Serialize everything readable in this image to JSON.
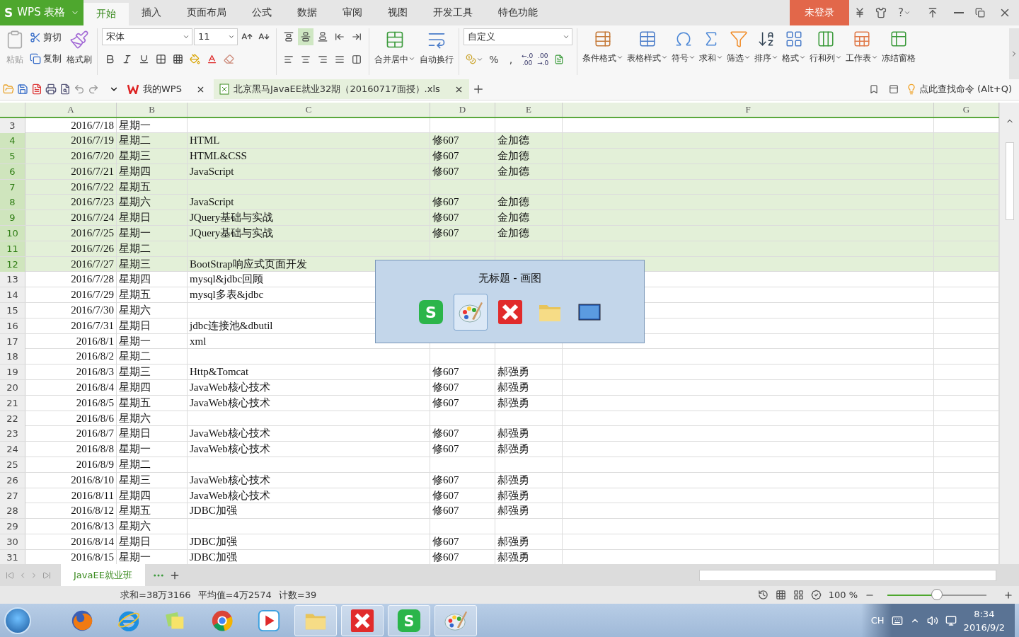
{
  "app_menu": {
    "logo": "S",
    "label": "WPS 表格"
  },
  "menu_tabs": [
    {
      "label": "开始",
      "selected": true
    },
    {
      "label": "插入",
      "selected": false
    },
    {
      "label": "页面布局",
      "selected": false
    },
    {
      "label": "公式",
      "selected": false
    },
    {
      "label": "数据",
      "selected": false
    },
    {
      "label": "审阅",
      "selected": false
    },
    {
      "label": "视图",
      "selected": false
    },
    {
      "label": "开发工具",
      "selected": false
    },
    {
      "label": "特色功能",
      "selected": false
    }
  ],
  "login_button": "未登录",
  "help_label": "?",
  "ribbon": {
    "paste": {
      "label": "粘贴",
      "disabled": true
    },
    "cut": "剪切",
    "copy": "复制",
    "format_painter": "格式刷",
    "font_name": "宋体",
    "font_size": "11",
    "merge": "合并居中",
    "wrap": "自动换行",
    "number_format": "自定义",
    "number_glyphs": [
      "%",
      ","
    ],
    "decimal_buttons": [
      {
        "top": "←.0",
        "bottom": ".00"
      },
      {
        "top": ".00",
        "bottom": "→.0"
      }
    ],
    "commands": [
      {
        "kind": "conditional",
        "label": "条件格式",
        "dropdown": true
      },
      {
        "kind": "table-style",
        "label": "表格样式",
        "dropdown": true
      },
      {
        "kind": "symbol",
        "label": "符号",
        "dropdown": true
      },
      {
        "kind": "sum",
        "label": "求和",
        "dropdown": true
      },
      {
        "kind": "filter",
        "label": "筛选",
        "dropdown": true
      },
      {
        "kind": "sort",
        "label": "排序",
        "dropdown": true
      },
      {
        "kind": "format",
        "label": "格式",
        "dropdown": true
      },
      {
        "kind": "rows-cols",
        "label": "行和列",
        "dropdown": true
      },
      {
        "kind": "worksheet",
        "label": "工作表",
        "dropdown": true
      },
      {
        "kind": "freeze",
        "label": "冻结窗格",
        "dropdown": false
      }
    ]
  },
  "doc_tabs": [
    {
      "kind": "home",
      "label": "我的WPS",
      "selected": false
    },
    {
      "kind": "sheet",
      "label": "北京黑马JavaEE就业32期（20160717面授）.xls",
      "selected": true
    }
  ],
  "command_search": "点此查找命令 (Alt+Q)",
  "sheet": {
    "columns": [
      "A",
      "B",
      "C",
      "D",
      "E",
      "F",
      "G"
    ],
    "rows": [
      {
        "num": "3",
        "cells": [
          "2016/7/18",
          "星期一",
          "",
          "",
          ""
        ],
        "selected": false
      },
      {
        "num": "4",
        "cells": [
          "2016/7/19",
          "星期二",
          "HTML",
          "修607",
          "金加德"
        ],
        "selected": true
      },
      {
        "num": "5",
        "cells": [
          "2016/7/20",
          "星期三",
          "HTML&CSS",
          "修607",
          "金加德"
        ],
        "selected": true
      },
      {
        "num": "6",
        "cells": [
          "2016/7/21",
          "星期四",
          "JavaScript",
          "修607",
          "金加德"
        ],
        "selected": true
      },
      {
        "num": "7",
        "cells": [
          "2016/7/22",
          "星期五",
          "",
          "",
          ""
        ],
        "selected": true
      },
      {
        "num": "8",
        "cells": [
          "2016/7/23",
          "星期六",
          "JavaScript",
          "修607",
          "金加德"
        ],
        "selected": true
      },
      {
        "num": "9",
        "cells": [
          "2016/7/24",
          "星期日",
          "JQuery基础与实战",
          "修607",
          "金加德"
        ],
        "selected": true
      },
      {
        "num": "10",
        "cells": [
          "2016/7/25",
          "星期一",
          "JQuery基础与实战",
          "修607",
          "金加德"
        ],
        "selected": true
      },
      {
        "num": "11",
        "cells": [
          "2016/7/26",
          "星期二",
          "",
          "",
          ""
        ],
        "selected": true
      },
      {
        "num": "12",
        "cells": [
          "2016/7/27",
          "星期三",
          "BootStrap响应式页面开发",
          "",
          ""
        ],
        "selected": true
      },
      {
        "num": "13",
        "cells": [
          "2016/7/28",
          "星期四",
          "mysql&jdbc回顾",
          "",
          ""
        ],
        "selected": false
      },
      {
        "num": "14",
        "cells": [
          "2016/7/29",
          "星期五",
          "mysql多表&jdbc",
          "",
          ""
        ],
        "selected": false
      },
      {
        "num": "15",
        "cells": [
          "2016/7/30",
          "星期六",
          "",
          "",
          ""
        ],
        "selected": false
      },
      {
        "num": "16",
        "cells": [
          "2016/7/31",
          "星期日",
          "jdbc连接池&dbutil",
          "",
          ""
        ],
        "selected": false
      },
      {
        "num": "17",
        "cells": [
          "2016/8/1",
          "星期一",
          "xml",
          "",
          ""
        ],
        "selected": false
      },
      {
        "num": "18",
        "cells": [
          "2016/8/2",
          "星期二",
          "",
          "",
          ""
        ],
        "selected": false
      },
      {
        "num": "19",
        "cells": [
          "2016/8/3",
          "星期三",
          "Http&Tomcat",
          "修607",
          "郝强勇"
        ],
        "selected": false
      },
      {
        "num": "20",
        "cells": [
          "2016/8/4",
          "星期四",
          "JavaWeb核心技术",
          "修607",
          "郝强勇"
        ],
        "selected": false
      },
      {
        "num": "21",
        "cells": [
          "2016/8/5",
          "星期五",
          "JavaWeb核心技术",
          "修607",
          "郝强勇"
        ],
        "selected": false
      },
      {
        "num": "22",
        "cells": [
          "2016/8/6",
          "星期六",
          "",
          "",
          ""
        ],
        "selected": false
      },
      {
        "num": "23",
        "cells": [
          "2016/8/7",
          "星期日",
          "JavaWeb核心技术",
          "修607",
          "郝强勇"
        ],
        "selected": false
      },
      {
        "num": "24",
        "cells": [
          "2016/8/8",
          "星期一",
          "JavaWeb核心技术",
          "修607",
          "郝强勇"
        ],
        "selected": false
      },
      {
        "num": "25",
        "cells": [
          "2016/8/9",
          "星期二",
          "",
          "",
          ""
        ],
        "selected": false
      },
      {
        "num": "26",
        "cells": [
          "2016/8/10",
          "星期三",
          "JavaWeb核心技术",
          "修607",
          "郝强勇"
        ],
        "selected": false
      },
      {
        "num": "27",
        "cells": [
          "2016/8/11",
          "星期四",
          "JavaWeb核心技术",
          "修607",
          "郝强勇"
        ],
        "selected": false
      },
      {
        "num": "28",
        "cells": [
          "2016/8/12",
          "星期五",
          "JDBC加强",
          "修607",
          "郝强勇"
        ],
        "selected": false
      },
      {
        "num": "29",
        "cells": [
          "2016/8/13",
          "星期六",
          "",
          "",
          ""
        ],
        "selected": false
      },
      {
        "num": "30",
        "cells": [
          "2016/8/14",
          "星期日",
          "JDBC加强",
          "修607",
          "郝强勇"
        ],
        "selected": false
      },
      {
        "num": "31",
        "cells": [
          "2016/8/15",
          "星期一",
          "JDBC加强",
          "修607",
          "郝强勇"
        ],
        "selected": false
      }
    ]
  },
  "sheet_tabs": [
    {
      "label": "JavaEE就业班",
      "selected": true
    }
  ],
  "status": {
    "sum": "求和=38万3166",
    "average": "平均值=4万2574",
    "count": "计数=39",
    "zoom": "100 %",
    "zoom_slider": {
      "level": 0.5
    }
  },
  "switcher": {
    "title": "无标题 - 画图",
    "apps": [
      {
        "kind": "wps",
        "glyph": "S",
        "selected": false
      },
      {
        "kind": "paint",
        "selected": true
      },
      {
        "kind": "xmind",
        "selected": false
      },
      {
        "kind": "folder",
        "selected": false
      },
      {
        "kind": "desktop",
        "selected": false
      }
    ]
  },
  "taskbar": {
    "apps": [
      {
        "kind": "firefox",
        "open": false
      },
      {
        "kind": "ie",
        "open": false
      },
      {
        "kind": "notes",
        "open": false
      },
      {
        "kind": "chrome",
        "open": false
      },
      {
        "kind": "player",
        "open": false
      },
      {
        "kind": "folder",
        "open": true
      },
      {
        "kind": "xmind",
        "open": true
      },
      {
        "kind": "wps",
        "glyph": "S",
        "open": true
      },
      {
        "kind": "paint",
        "open": true
      }
    ],
    "ime": "CH",
    "time": "8:34",
    "date": "2016/9/2"
  }
}
